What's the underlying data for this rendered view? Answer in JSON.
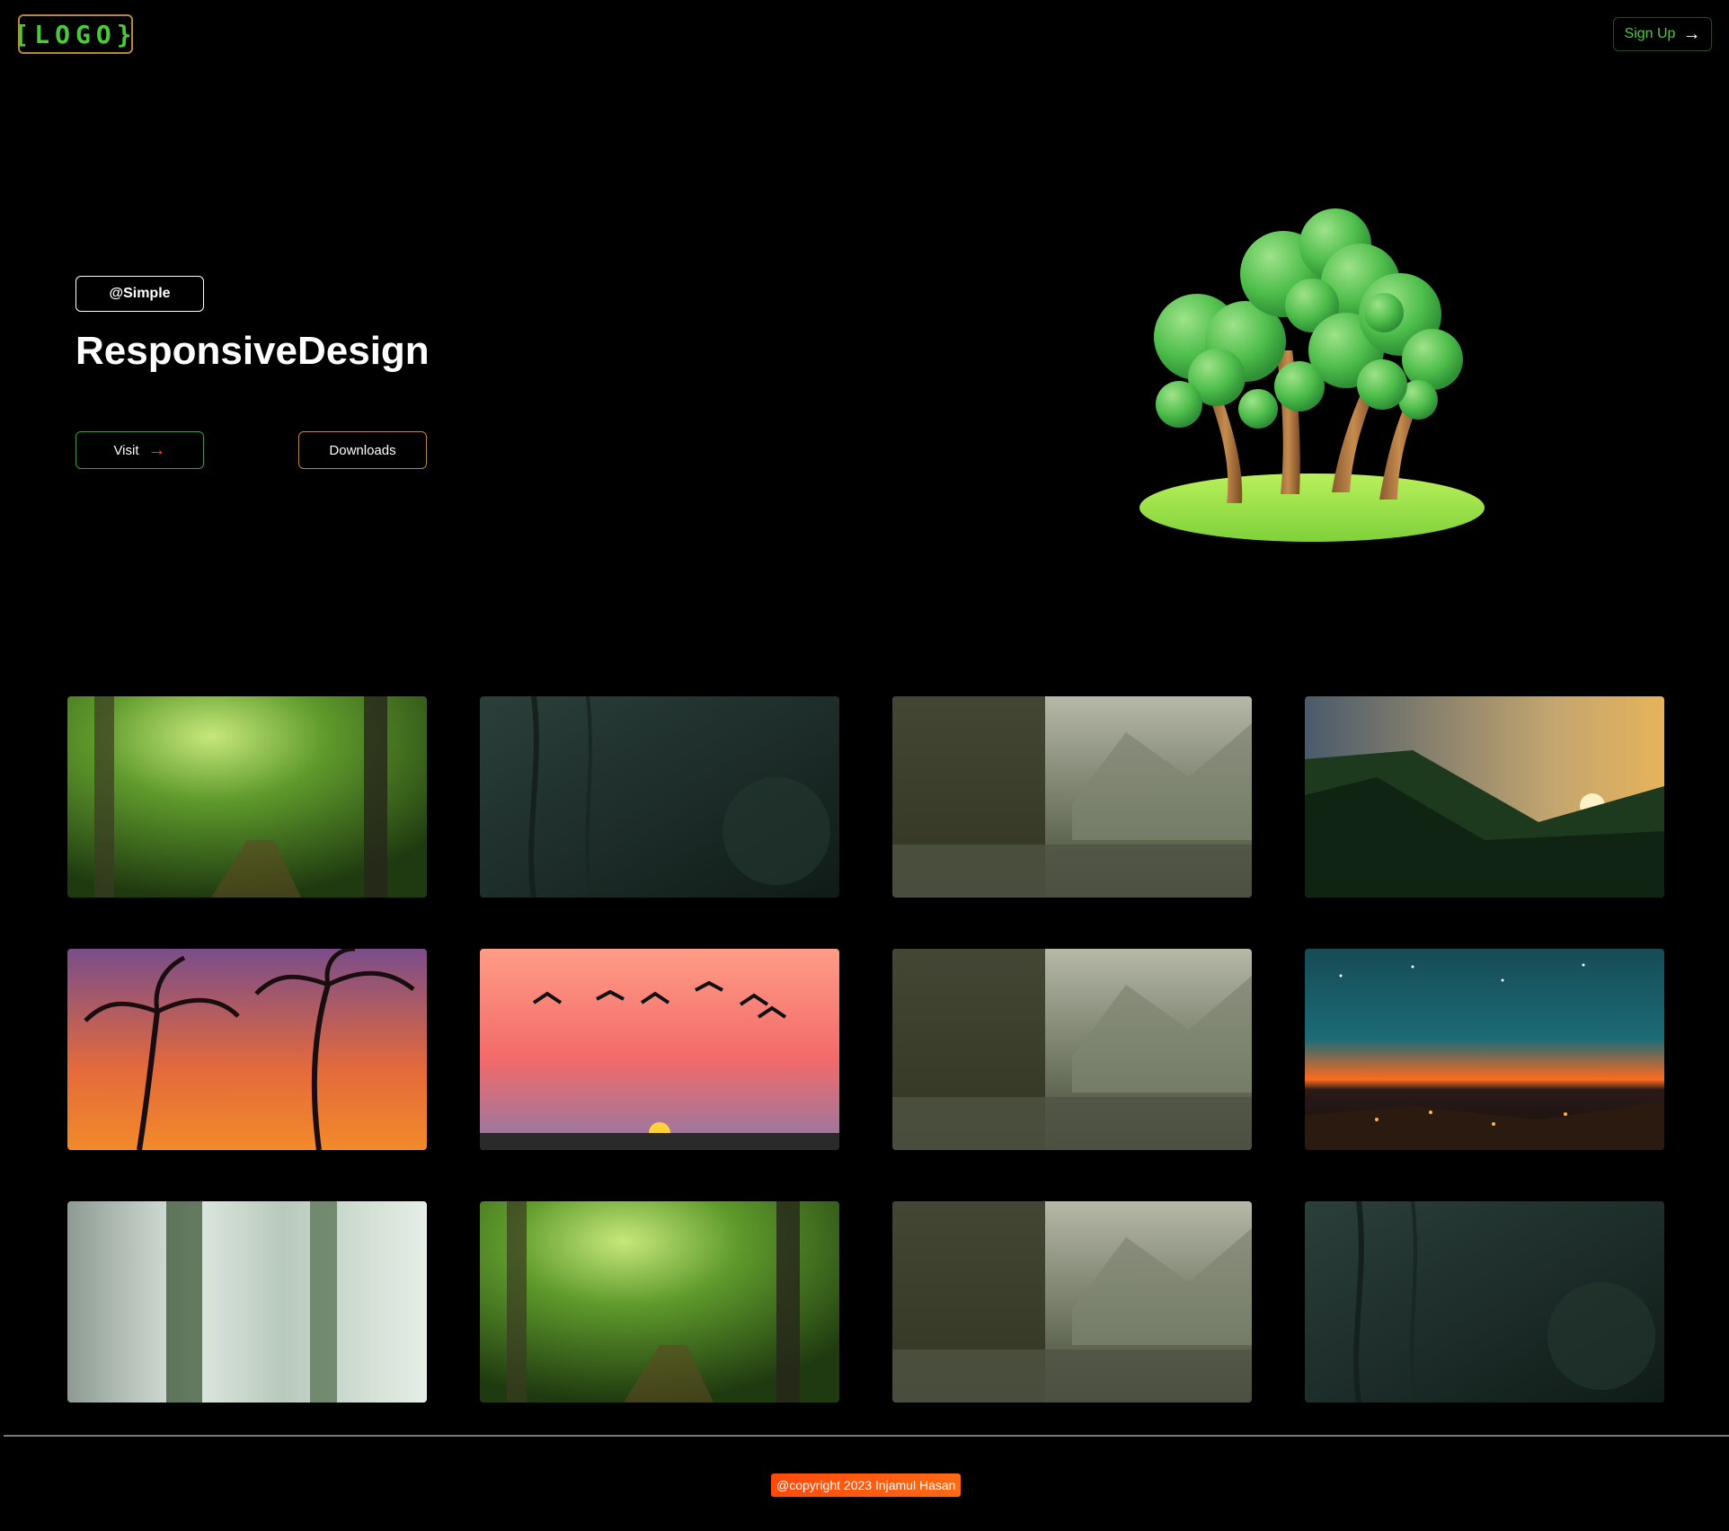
{
  "header": {
    "logo_text": "[LOGO}",
    "signup_label": "Sign Up"
  },
  "hero": {
    "tag": "@Simple",
    "title": "ResponsiveDesign",
    "visit_label": "Visit",
    "downloads_label": "Downloads",
    "illustration": "tree-island-illustration"
  },
  "gallery": {
    "items": [
      "forest-path-image",
      "dark-jungle-image",
      "misty-lake-tree-image",
      "mountain-sunset-forest-image",
      "palm-tree-sunset-image",
      "birds-sunset-image",
      "misty-lake-tree-image",
      "night-city-lights-image",
      "blurred-forest-image",
      "forest-path-image",
      "misty-lake-tree-image",
      "dark-jungle-image"
    ]
  },
  "footer": {
    "copyright": "@copyright 2023 Injamul Hasan"
  },
  "colors": {
    "background": "#000000",
    "accent_green": "#4ccb3a",
    "accent_gold": "#b8893a",
    "accent_orange": "#ff4a0c"
  }
}
